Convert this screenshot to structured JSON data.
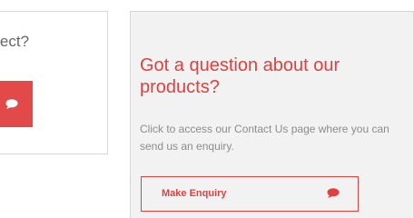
{
  "left_card": {
    "text": "roject?"
  },
  "right_card": {
    "title": "Got a question about our products?",
    "description": "Click to access our Contact Us page where you can send us an enquiry.",
    "button_label": "Make Enquiry"
  },
  "icons": {
    "chat": "chat-bubble-icon"
  },
  "colors": {
    "accent": "#e0403e",
    "left_button_bg": "#e24a4a",
    "card_bg": "#f2f2f2",
    "muted_text": "#8c8c8c"
  }
}
